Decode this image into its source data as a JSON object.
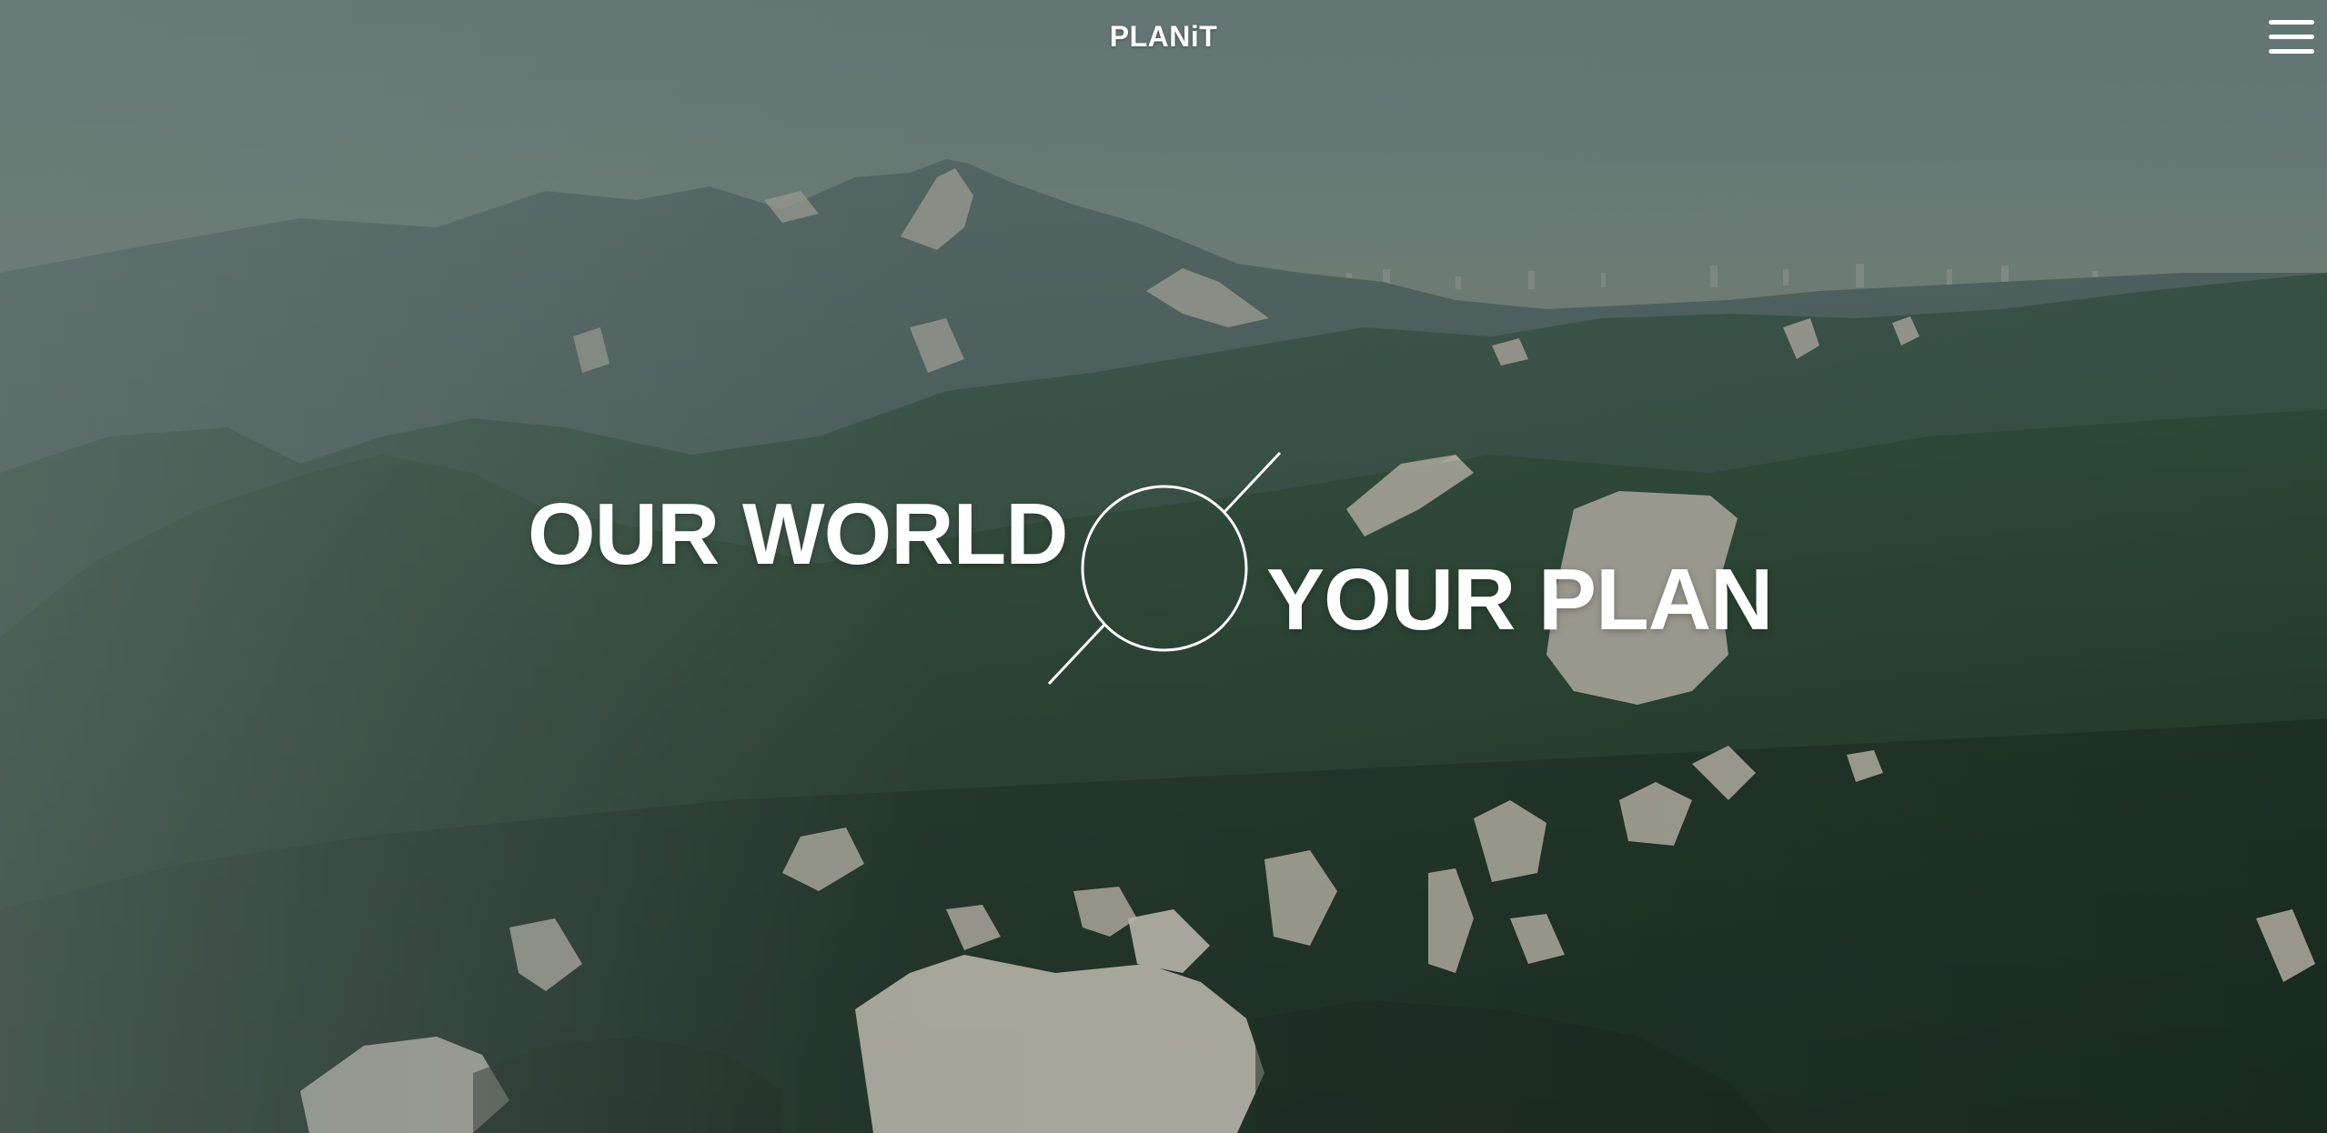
{
  "header": {
    "logo": "PLANiT",
    "menu_icon": "hamburger-menu-icon"
  },
  "hero": {
    "headline_left": "OUR WORLD",
    "headline_right": "YOUR PLAN",
    "emblem_icon": "circle-slash-emblem-icon"
  },
  "colors": {
    "text": "#ffffff",
    "sky_top": "#6f8683",
    "forest": "#2e4a3a",
    "rock": "#cfc8bd"
  }
}
